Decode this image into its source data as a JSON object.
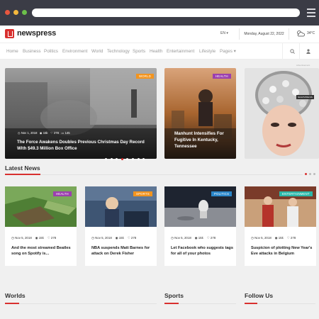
{
  "site": {
    "logo_text": "newspress",
    "language": "EN",
    "date": "Monday, August 22, 2022",
    "temperature": "34°C",
    "advertisement_label": "Advertisement"
  },
  "nav": {
    "items": [
      "Home",
      "Business",
      "Politics",
      "Environment",
      "World",
      "Technology",
      "Sports",
      "Health",
      "Entertainment",
      "Lifestyle",
      "Pages"
    ]
  },
  "hero": {
    "main": {
      "badge": "WORLD",
      "date": "Nov 1, 2018",
      "views": "15k",
      "likes": "278",
      "comments": "145",
      "title": "The Force Awakens Doubles Previous Christmas Day Record With $49.3 Million Box Office"
    },
    "side": {
      "badge": "HEALTH",
      "title": "Manhunt Intensifies For Fugitive In Kentucky, Tennessee"
    },
    "ad": {
      "badge": "NEWSPRESS"
    }
  },
  "latest": {
    "title": "Latest News",
    "cards": [
      {
        "badge": "HEALTH",
        "date": "Nov 5, 2018",
        "views": "15k",
        "likes": "278",
        "title": "And the most streamed Beatles song on Spotify is..."
      },
      {
        "badge": "SPORTS",
        "date": "Nov 5, 2018",
        "views": "15k",
        "likes": "278",
        "title": "NBA suspends Matt Barnes for attack on Derek Fisher"
      },
      {
        "badge": "POLITICS",
        "date": "Nov 5, 2018",
        "views": "15k",
        "likes": "278",
        "title": "Let Facebook who suggests tags for all of your photos"
      },
      {
        "badge": "ENTERTAINMENT",
        "date": "Nov 5, 2018",
        "views": "15k",
        "likes": "278",
        "title": "Suspicion of plotting New Year's Eve attacks in Belgium"
      }
    ]
  },
  "bottom": {
    "worlds": "Worlds",
    "sports": "Sports",
    "follow": "Follow Us"
  },
  "colors": {
    "accent": "#d8302f",
    "world": "#f3941e",
    "health": "#9b3fae",
    "sports": "#f3941e",
    "politics": "#2a86c9",
    "entertainment": "#2bb7a9"
  }
}
